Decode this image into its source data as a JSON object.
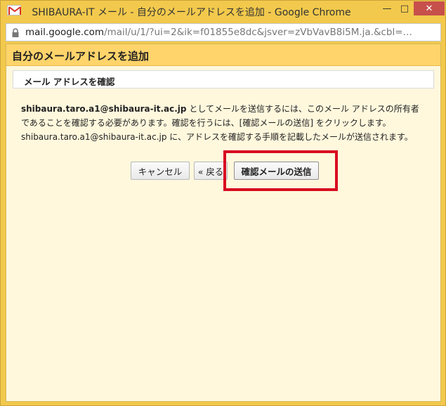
{
  "window": {
    "title": "SHIBAURA-IT メール - 自分のメールアドレスを追加 - Google Chrome",
    "minimize_label": "—",
    "maximize_label": "□",
    "close_label": "✕"
  },
  "address_bar": {
    "host": "mail.google.com",
    "path": "/mail/u/1/?ui=2&ik=f01855e8dc&jsver=zVbVavB8i5M.ja.&cbl=…"
  },
  "dialog": {
    "title": "自分のメールアドレスを追加",
    "section_title": "メール アドレスを確認",
    "description": {
      "email": "shibaura.taro.a1@shibaura-it.ac.jp",
      "line1_rest": " としてメールを送信するには、このメール アドレスの所有者",
      "line2": "であることを確認する必要があります。確認を行うには、[確認メールの送信] をクリックします。",
      "line3": "shibaura.taro.a1@shibaura-it.ac.jp に、アドレスを確認する手順を記載したメールが送信されます。"
    },
    "buttons": {
      "cancel": "キャンセル",
      "back": "« 戻る",
      "send": "確認メールの送信"
    }
  },
  "colors": {
    "highlight": "#d80c20",
    "header": "#ffd46b",
    "panel": "#fff8dd"
  }
}
